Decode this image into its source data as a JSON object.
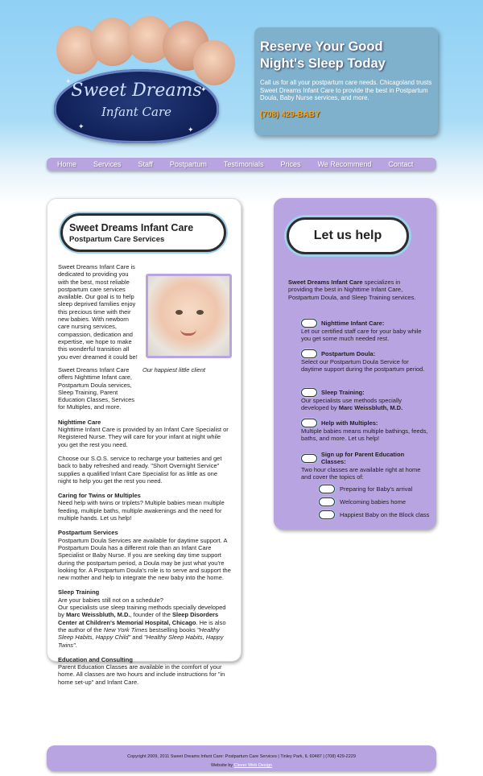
{
  "logo": {
    "title": "Sweet Dreams",
    "subtitle": "Infant Care"
  },
  "reserve": {
    "heading_line1": "Reserve Your Good",
    "heading_line2": "Night's Sleep Today",
    "text": "Call us for all your postpartum care needs. Chicagoland trusts Sweet Dreams Infant Care to provide the best in Postpartum Doula, Baby Nurse services, and more.",
    "phone": "(708) 429-BABY"
  },
  "nav": [
    "Home",
    "Services",
    "Staff",
    "Postpartum",
    "Testimonials",
    "Prices",
    "We Recommend",
    "Contact"
  ],
  "left": {
    "cloud_title": "Sweet Dreams Infant Care",
    "cloud_subtitle": "Postpartum Care Services",
    "intro": "Sweet Dreams Infant Care is dedicated to providing you with the best, most reliable postpartum care services available. Our goal is to help sleep deprived families enjoy this precious time with their new babies. With newborn care nursing services, compassion, dedication and expertise, we hope to make this wonderful transition all you ever dreamed it could be!",
    "caption": "Our happiest little client",
    "offers": "Sweet Dreams Infant Care offers Nighttime Infant care, Postpartum Doula services, Sleep Training, Parent Education Classes, Services for Multiples, and more.",
    "nighttime_heading": "Nighttime Care",
    "nighttime_p1": "Nighttime Infant Care is provided by an Infant Care Specialist or Registered Nurse. They will care for your infant at night while you get the rest you need.",
    "nighttime_p2": "Choose our S.O.S. service to recharge your batteries and get back to baby refreshed and ready. \"Short Overnight Service\" supplies a qualified Infant Care Specialist for as little as one night to help you get the rest you need.",
    "twins_heading": "Caring for Twins or Multiples",
    "twins_p": "Need help with twins or triplets? Multiple babies mean multiple feeding, multiple baths, multiple awakenings and the need for multiple hands. Let us help!",
    "postpartum_heading": "Postpartum Services",
    "postpartum_p": "Postpartum Doula Services are available for daytime support. A Postpartum Doula has a different role than an Infant Care Specialist or Baby Nurse. If you are seeking day time support during the postpartum period, a Doula may be just what you're looking for. A Postpartum Doula's role is to serve and support the new mother and help to integrate the new baby into the home.",
    "sleep_heading": "Sleep Training",
    "sleep_q": "Are your babies still not on a schedule?",
    "sleep_p_a": "Our specialists use sleep training methods specially developed by ",
    "sleep_p_name": "Marc Weissbluth, M.D.",
    "sleep_p_b": ", founder of the ",
    "sleep_p_center": "Sleep Disorders Center at Children's Memorial Hospital, Chicago",
    "sleep_p_c": ". He is also the author of the ",
    "sleep_p_nyt": "New York Times",
    "sleep_p_d": " bestselling books ",
    "sleep_p_book1": "\"Healthy Sleep Habits, Happy Child\"",
    "sleep_p_e": " and ",
    "sleep_p_book2": "\"Healthy Sleep Habits, Happy Twins\"",
    "sleep_p_f": ".",
    "edu_heading": "Education and Consulting",
    "edu_p": "Parent Education Classes are available in the comfort of your home. All classes are two hours and include instructions for \"in home set-up\" and Infant Care."
  },
  "right": {
    "cloud_label": "Let us help",
    "intro_bold": "Sweet Dreams Infant Care",
    "intro_rest": " specializes in providing the best in Nighttime Infant Care, Postpartum Doula, and Sleep Training services.",
    "services": [
      {
        "title": "Nighttime Infant Care:",
        "text": "Let our certified staff care for your baby while you get some much needed rest."
      },
      {
        "title": "Postpartum Doula:",
        "text": "Select our Postpartum Doula Service for daytime support during the postpartum period."
      },
      {
        "title": "Sleep Training:",
        "text_a": "Our specialists use methods specially developed by ",
        "text_b": "Marc Weissbluth, M.D."
      },
      {
        "title": "Help with Multiples:",
        "text": "Multiple babies means multiple bathings, feeds, baths, and more. Let us help!"
      },
      {
        "title": "Sign up for Parent Education Classes:",
        "text": "Two hour classes are available right at home and cover the topics of:"
      }
    ],
    "topics": [
      "Preparing for Baby's arrival",
      "Welcoming babies home",
      "Happiest Baby on the Block class"
    ]
  },
  "footer": {
    "line1": "Copyright 2009, 2011 Sweet Dreams Infant Care: Postpartum Care Services | Tinley Park, IL 60487 | (708) 429-2229",
    "line2_prefix": "Website by",
    "line2_link": "Clever Web Design"
  },
  "colors": {
    "lavender": "#b8a4e0",
    "phone_orange": "#f5a623",
    "reserve_blue": "#7fb1cc"
  }
}
